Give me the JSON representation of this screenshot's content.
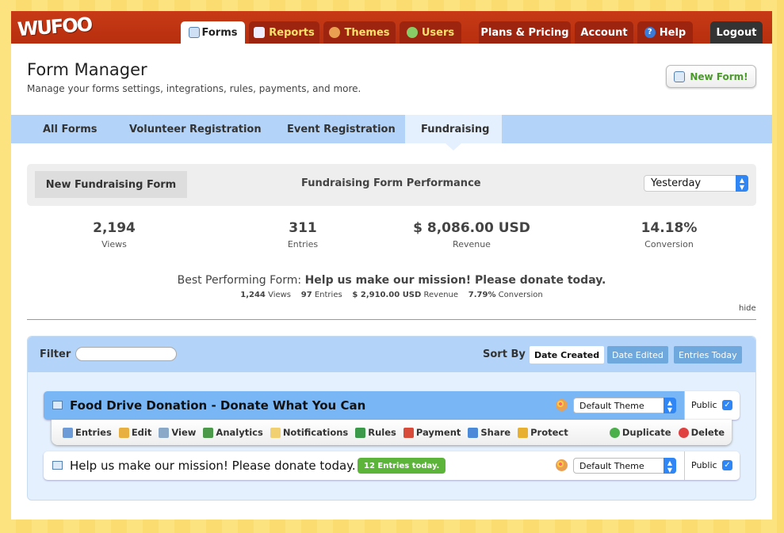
{
  "app": {
    "logo": "WUFOO"
  },
  "topnav": {
    "tabs": [
      {
        "label": "Forms",
        "icon": "forms-icon"
      },
      {
        "label": "Reports",
        "icon": "reports-icon"
      },
      {
        "label": "Themes",
        "icon": "palette-icon"
      },
      {
        "label": "Users",
        "icon": "users-icon"
      },
      {
        "label": "Plans & Pricing"
      },
      {
        "label": "Account"
      },
      {
        "label": "Help",
        "icon": "help-icon"
      },
      {
        "label": "Logout"
      }
    ]
  },
  "header": {
    "title": "Form Manager",
    "subtitle": "Manage your forms settings, integrations, rules, payments, and more.",
    "new_form": "New Form!"
  },
  "subnav": {
    "tabs": [
      "All Forms",
      "Volunteer Registration",
      "Event Registration",
      "Fundraising"
    ],
    "active": "Fundraising"
  },
  "performance": {
    "new_button": "New Fundraising Form",
    "title": "Fundraising Form Performance",
    "period": "Yesterday",
    "stats": [
      {
        "value": "2,194",
        "label": "Views"
      },
      {
        "value": "311",
        "label": "Entries"
      },
      {
        "value": "$ 8,086.00 USD",
        "label": "Revenue"
      },
      {
        "value": "14.18%",
        "label": "Conversion"
      }
    ],
    "best_label": "Best Performing Form:",
    "best_name": "Help us make our mission! Please donate today.",
    "best_stats": [
      {
        "value": "1,244",
        "label": "Views"
      },
      {
        "value": "97",
        "label": "Entries"
      },
      {
        "value": "$ 2,910.00 USD",
        "label": "Revenue"
      },
      {
        "value": "7.79%",
        "label": "Conversion"
      }
    ],
    "hide": "hide"
  },
  "list": {
    "filter_label": "Filter",
    "filter_value": "",
    "sort_label": "Sort By :",
    "sort_options": [
      "Date Created",
      "Date Edited",
      "Entries Today"
    ],
    "sort_active": "Date Created",
    "forms": [
      {
        "name": "Food Drive Donation - Donate What You Can",
        "theme": "Default Theme",
        "public_label": "Public",
        "public": true,
        "selected": true
      },
      {
        "name": "Help us make our mission! Please donate today.",
        "badge": "12 Entries today.",
        "theme": "Default Theme",
        "public_label": "Public",
        "public": true,
        "selected": false
      }
    ],
    "actions": [
      {
        "label": "Entries",
        "color": "#6d9bd8"
      },
      {
        "label": "Edit",
        "color": "#e8b040"
      },
      {
        "label": "View",
        "color": "#8aa8c8"
      },
      {
        "label": "Analytics",
        "color": "#4a9a4a"
      },
      {
        "label": "Notifications",
        "color": "#f0d070"
      },
      {
        "label": "Rules",
        "color": "#3a9a4a"
      },
      {
        "label": "Payment",
        "color": "#d84a3a"
      },
      {
        "label": "Share",
        "color": "#4a8ad8"
      },
      {
        "label": "Protect",
        "color": "#e8b030"
      },
      {
        "label": "Duplicate",
        "color": "#4ab04a"
      },
      {
        "label": "Delete",
        "color": "#e04040"
      }
    ]
  }
}
